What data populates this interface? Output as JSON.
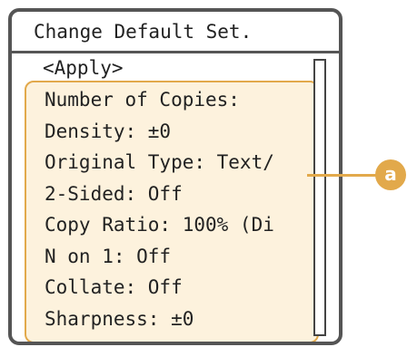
{
  "screen": {
    "title": "Change Default Set.",
    "apply_label": "<Apply>",
    "items": [
      {
        "label": "Number of  Copies:"
      },
      {
        "label": "Density: ±0"
      },
      {
        "label": "Original Type: Text/"
      },
      {
        "label": "2-Sided: Off"
      },
      {
        "label": "Copy Ratio: 100% (Di"
      },
      {
        "label": "N on 1: Off"
      },
      {
        "label": "Collate: Off"
      },
      {
        "label": "Sharpness: ±0"
      }
    ]
  },
  "callout": {
    "label": "a"
  },
  "colors": {
    "highlight_fill": "#fdf2dd",
    "highlight_border": "#e2a94b",
    "frame": "#555555",
    "text": "#222222"
  }
}
